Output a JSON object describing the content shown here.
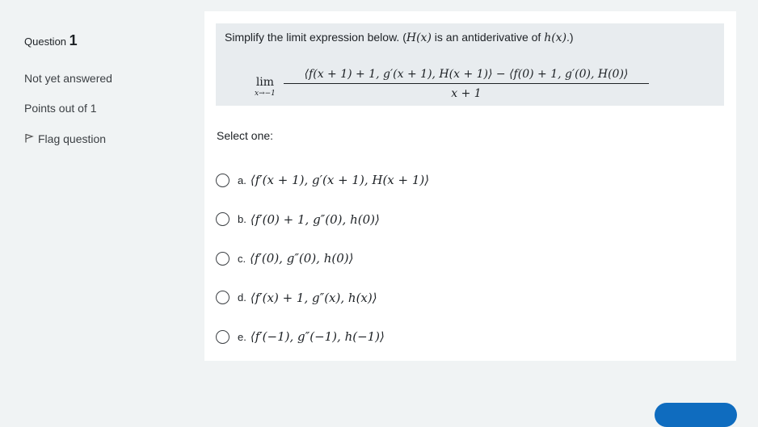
{
  "info": {
    "question_label": "Question",
    "question_number": "1",
    "state": "Not yet answered",
    "grade": "Points out of 1",
    "flag_label": "Flag question",
    "flag_icon": "flag-icon"
  },
  "question": {
    "text_before": "Simplify the limit expression below. (",
    "text_Hx": "H(x)",
    "text_middle": " is an antiderivative of ",
    "text_hx": "h(x)",
    "text_after": ".)",
    "limit_word": "lim",
    "limit_sub": "x→−1",
    "numerator": "⟨f(x + 1) + 1, g′(x + 1), H(x + 1)⟩ − ⟨f(0) + 1, g′(0), H(0)⟩",
    "denominator": "x + 1"
  },
  "prompt": "Select one:",
  "options": [
    {
      "letter": "a.",
      "text": "⟨f′(x + 1), g′(x + 1), H(x + 1)⟩"
    },
    {
      "letter": "b.",
      "text": "⟨f′(0) + 1, g″(0), h(0)⟩"
    },
    {
      "letter": "c.",
      "text": "⟨f′(0), g″(0), h(0)⟩"
    },
    {
      "letter": "d.",
      "text": "⟨f′(x) + 1, g″(x), h(x)⟩"
    },
    {
      "letter": "e.",
      "text": "⟨f′(−1), g″(−1), h(−1)⟩"
    }
  ],
  "colors": {
    "page_bg": "#f0f3f4",
    "content_bg": "#ffffff",
    "qtext_bg": "#e8ecef",
    "primary": "#0f6cbf"
  }
}
